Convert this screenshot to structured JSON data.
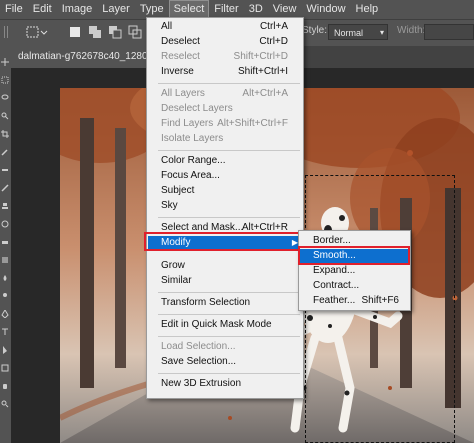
{
  "menubar": {
    "items": [
      "File",
      "Edit",
      "Image",
      "Layer",
      "Type",
      "Select",
      "Filter",
      "3D",
      "View",
      "Window",
      "Help"
    ],
    "active": "Select"
  },
  "options_bar": {
    "style_label": "Style:",
    "style_value": "Normal",
    "width_label": "Width:"
  },
  "document": {
    "tab_title": "dalmatian-g762678c40_1280.jp"
  },
  "select_menu": {
    "items": [
      {
        "label": "All",
        "shortcut": "Ctrl+A"
      },
      {
        "label": "Deselect",
        "shortcut": "Ctrl+D"
      },
      {
        "label": "Reselect",
        "shortcut": "Shift+Ctrl+D"
      },
      {
        "label": "Inverse",
        "shortcut": "Shift+Ctrl+I"
      },
      {
        "label": "All Layers",
        "shortcut": "Alt+Ctrl+A"
      },
      {
        "label": "Deselect Layers",
        "shortcut": ""
      },
      {
        "label": "Find Layers",
        "shortcut": "Alt+Shift+Ctrl+F"
      },
      {
        "label": "Isolate Layers",
        "shortcut": ""
      },
      {
        "label": "Color Range...",
        "shortcut": ""
      },
      {
        "label": "Focus Area...",
        "shortcut": ""
      },
      {
        "label": "Subject",
        "shortcut": ""
      },
      {
        "label": "Sky",
        "shortcut": ""
      },
      {
        "label": "Select and Mask...",
        "shortcut": "Alt+Ctrl+R"
      },
      {
        "label": "Modify",
        "shortcut": ""
      },
      {
        "label": "Grow",
        "shortcut": ""
      },
      {
        "label": "Similar",
        "shortcut": ""
      },
      {
        "label": "Transform Selection",
        "shortcut": ""
      },
      {
        "label": "Edit in Quick Mask Mode",
        "shortcut": ""
      },
      {
        "label": "Load Selection...",
        "shortcut": ""
      },
      {
        "label": "Save Selection...",
        "shortcut": ""
      },
      {
        "label": "New 3D Extrusion",
        "shortcut": ""
      }
    ]
  },
  "modify_submenu": {
    "items": [
      {
        "label": "Border...",
        "shortcut": ""
      },
      {
        "label": "Smooth...",
        "shortcut": ""
      },
      {
        "label": "Expand...",
        "shortcut": ""
      },
      {
        "label": "Contract...",
        "shortcut": ""
      },
      {
        "label": "Feather...",
        "shortcut": "Shift+F6"
      }
    ]
  },
  "colors": {
    "highlight": "#0d6fcf",
    "annotation_red": "#e0202c",
    "menubar_bg": "#535353",
    "menu_bg": "#f0f0f0"
  }
}
